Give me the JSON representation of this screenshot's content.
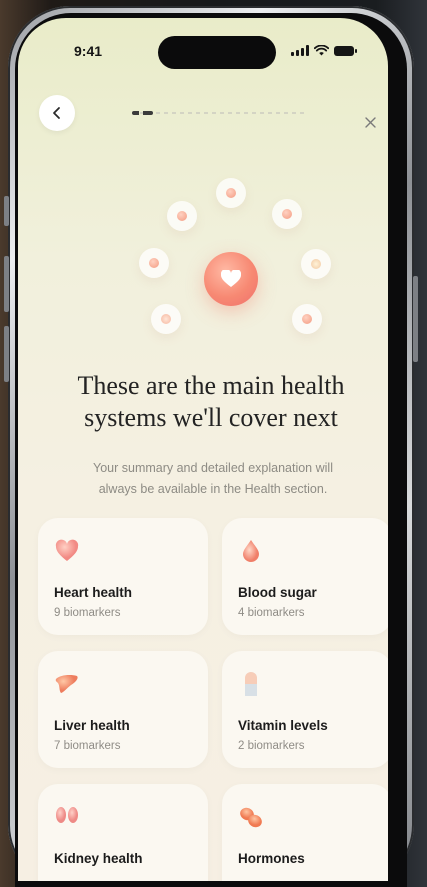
{
  "status_bar": {
    "time": "9:41",
    "icons": [
      "signal-icon",
      "wifi-icon",
      "battery-icon"
    ]
  },
  "nav": {
    "back_icon": "chevron-left-icon",
    "close_icon": "close-icon",
    "progress_fraction": 0.12
  },
  "illustration": {
    "center_icon": "heart-icon",
    "orbit_icons": [
      "kidney-icon",
      "drop-icon",
      "pill-icon",
      "hormones-icon",
      "capsule-icon",
      "liver-icon",
      "heart-icon",
      "drop-icon"
    ]
  },
  "headline": {
    "line1": "These are the main health",
    "line2": "systems we'll cover next"
  },
  "subtext": {
    "line1": "Your summary and detailed explanation will",
    "line2": "always be available in the Health section."
  },
  "systems": [
    {
      "title": "Heart health",
      "subtitle": "9 biomarkers",
      "icon": "heart-icon"
    },
    {
      "title": "Blood sugar",
      "subtitle": "4 biomarkers",
      "icon": "drop-icon"
    },
    {
      "title": "Liver health",
      "subtitle": "7 biomarkers",
      "icon": "liver-icon"
    },
    {
      "title": "Vitamin levels",
      "subtitle": "2 biomarkers",
      "icon": "capsule-icon"
    },
    {
      "title": "Kidney health",
      "subtitle": "",
      "icon": "kidney-icon"
    },
    {
      "title": "Hormones",
      "subtitle": "",
      "icon": "hormones-icon"
    }
  ],
  "colors": {
    "accent": "#f47a6c",
    "background": "#f3efdd",
    "card": "#fbf8f1",
    "text": "#232323",
    "muted": "#8d8b84"
  }
}
